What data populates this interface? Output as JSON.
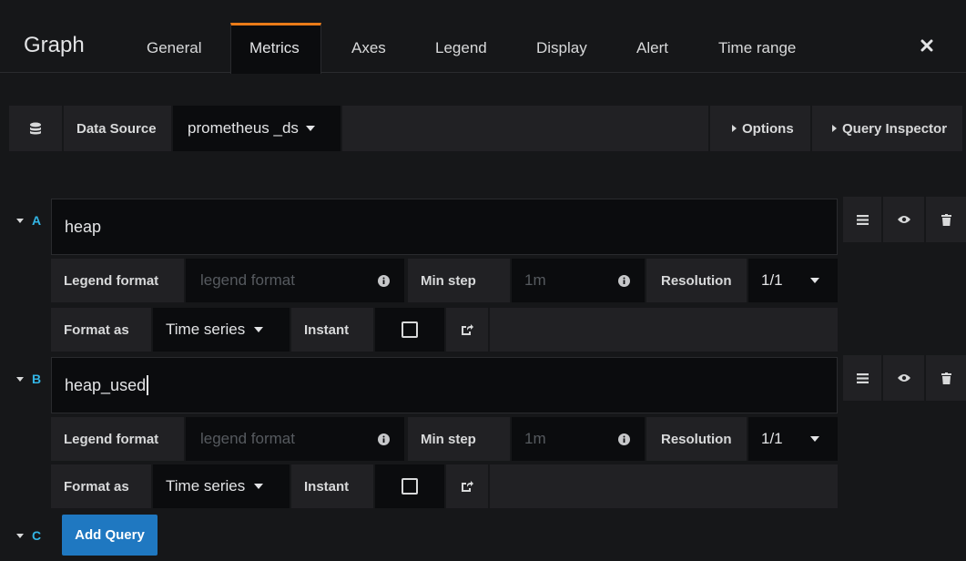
{
  "header": {
    "title": "Graph",
    "tabs": [
      "General",
      "Metrics",
      "Axes",
      "Legend",
      "Display",
      "Alert",
      "Time range"
    ],
    "active_tab": "Metrics",
    "close_icon": "close-icon"
  },
  "datasource": {
    "label": "Data Source",
    "value": "prometheus _ds",
    "options_label": "Options",
    "inspector_label": "Query Inspector",
    "icon": "database-icon"
  },
  "queries": [
    {
      "letter": "A",
      "expr": "heap",
      "legend_label": "Legend format",
      "legend_placeholder": "legend format",
      "minstep_label": "Min step",
      "minstep_placeholder": "1m",
      "resolution_label": "Resolution",
      "resolution_value": "1/1",
      "format_label": "Format as",
      "format_value": "Time series",
      "instant_label": "Instant",
      "instant_checked": false
    },
    {
      "letter": "B",
      "expr": "heap_used",
      "legend_label": "Legend format",
      "legend_placeholder": "legend format",
      "minstep_label": "Min step",
      "minstep_placeholder": "1m",
      "resolution_label": "Resolution",
      "resolution_value": "1/1",
      "format_label": "Format as",
      "format_value": "Time series",
      "instant_label": "Instant",
      "instant_checked": false
    }
  ],
  "add_query": {
    "letter": "C",
    "label": "Add Query"
  },
  "colors": {
    "accent": "#33b5e5",
    "button": "#1f78c1",
    "tab_highlight": "#eb7b18"
  }
}
